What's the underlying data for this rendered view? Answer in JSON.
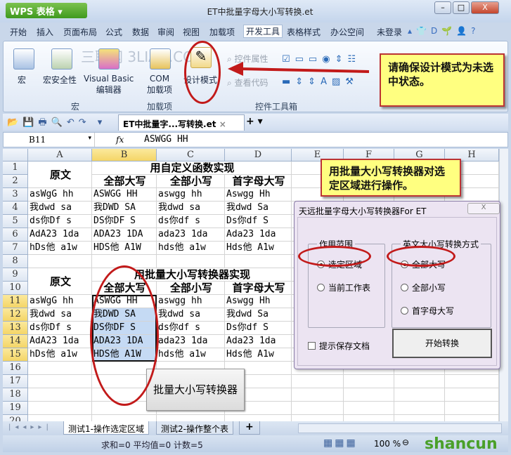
{
  "window": {
    "app_button": "WPS 表格",
    "title": "ET中批量字母大小写转换.et",
    "min": "–",
    "max": "□",
    "close": "X"
  },
  "menu": [
    "开始",
    "插入",
    "页面布局",
    "公式",
    "数据",
    "审阅",
    "视图",
    "加载项",
    "开发工具",
    "表格样式",
    "办公空间"
  ],
  "menu_active": "开发工具",
  "login": "未登录",
  "ribbon": {
    "macro": "宏",
    "macro_security": "宏安全性",
    "vb_editor_1": "Visual Basic",
    "vb_editor_2": "编辑器",
    "com_1": "COM",
    "com_2": "加载项",
    "design_mode": "设计模式",
    "control_props": "控件属性",
    "view_code": "查看代码",
    "group_macro": "宏",
    "group_addins": "加载项",
    "group_controls": "控件工具箱",
    "watermark": "三联网 3LIAN.COM"
  },
  "doc_tab": "ET中批量字...写转换.et",
  "formula_bar": {
    "cell_ref": "B11",
    "fx": "fx",
    "value": "ASWGG HH"
  },
  "columns": [
    "A",
    "B",
    "C",
    "D",
    "E",
    "F",
    "G",
    "H"
  ],
  "rows": [
    "1",
    "2",
    "3",
    "4",
    "5",
    "6",
    "7",
    "8",
    "9",
    "10",
    "11",
    "12",
    "13",
    "14",
    "15",
    "16",
    "17",
    "18",
    "19",
    "20"
  ],
  "table1": {
    "original": "原文",
    "title": "用自定义函数实现",
    "headers": [
      "全部大写",
      "全部小写",
      "首字母大写"
    ],
    "data": [
      [
        "asWgG hh",
        "ASWGG HH",
        "aswgg hh",
        "Aswgg Hh"
      ],
      [
        "我dwd sa",
        "我DWD SA",
        "我dwd sa",
        "我dwd Sa"
      ],
      [
        "ds你Df s",
        "DS你DF S",
        "ds你df s",
        "Ds你df S"
      ],
      [
        "AdA23 1da",
        "ADA23 1DA",
        "ada23 1da",
        "Ada23 1da"
      ],
      [
        "hDs他 a1w",
        "HDS他 A1W",
        "hds他 a1w",
        "Hds他 A1w"
      ]
    ]
  },
  "table2": {
    "original": "原文",
    "title": "用批量大小写转换器实现",
    "headers": [
      "全部大写",
      "全部小写",
      "首字母大写"
    ],
    "data": [
      [
        "asWgG hh",
        "ASWGG HH",
        "aswgg hh",
        "Aswgg Hh"
      ],
      [
        "我dwd sa",
        "我DWD SA",
        "我dwd sa",
        "我dwd Sa"
      ],
      [
        "ds你Df s",
        "DS你DF S",
        "ds你df s",
        "Ds你df S"
      ],
      [
        "AdA23 1da",
        "ADA23 1DA",
        "ada23 1da",
        "Ada23 1da"
      ],
      [
        "hDs他 a1w",
        "HDS他 A1W",
        "hds他 a1w",
        "Hds他 A1w"
      ]
    ]
  },
  "sheet_button": "批量大小写转换器",
  "dialog": {
    "title": "天远批量字母大小写转换器For ET",
    "close": "X",
    "scope_label": "作用范围",
    "scope_options": [
      "选定区域",
      "当前工作表"
    ],
    "scope_selected": 0,
    "mode_label": "英文大小写转换方式",
    "mode_options": [
      "全部大写",
      "全部小写",
      "首字母大写"
    ],
    "mode_selected": 0,
    "prompt_save": "提示保存文档",
    "prompt_save_checked": false,
    "start": "开始转换"
  },
  "sheets": [
    "测试1-操作选定区域",
    "测试2-操作整个表"
  ],
  "active_sheet": 0,
  "status": {
    "text": "求和=0  平均值=0  计数=5",
    "zoom": "100 %"
  },
  "callouts": {
    "design": "请确保设计模式为未选中状态。",
    "range": "用批量大小写转换器对选定区域进行操作。"
  },
  "logo": "shancun.net",
  "colors": {
    "annotation_red": "#c21a1a",
    "callout_yellow": "#ffff80",
    "selection": "#c5daf4",
    "wps_green": "#4fa52a"
  }
}
